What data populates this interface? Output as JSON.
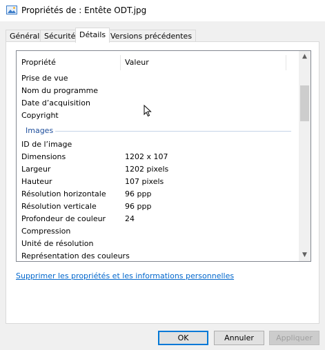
{
  "window": {
    "title": "Propriétés de : Entête ODT.jpg"
  },
  "tabs": [
    {
      "label": "Général",
      "active": false
    },
    {
      "label": "Sécurité",
      "active": false
    },
    {
      "label": "Détails",
      "active": true
    },
    {
      "label": "Versions précédentes",
      "active": false
    }
  ],
  "details": {
    "columns": {
      "property": "Propriété",
      "value": "Valeur"
    },
    "rows_before": [
      {
        "property": "Prise de vue",
        "value": ""
      },
      {
        "property": "Nom du programme",
        "value": ""
      },
      {
        "property": "Date d’acquisition",
        "value": ""
      },
      {
        "property": "Copyright",
        "value": ""
      }
    ],
    "group_label": "Images",
    "rows_images": [
      {
        "property": "ID de l’image",
        "value": ""
      },
      {
        "property": "Dimensions",
        "value": "1202 x 107"
      },
      {
        "property": "Largeur",
        "value": "1202 pixels"
      },
      {
        "property": "Hauteur",
        "value": "107 pixels"
      },
      {
        "property": "Résolution horizontale",
        "value": "96 ppp"
      },
      {
        "property": "Résolution verticale",
        "value": "96 ppp"
      },
      {
        "property": "Profondeur de couleur",
        "value": "24"
      },
      {
        "property": "Compression",
        "value": ""
      },
      {
        "property": "Unité de résolution",
        "value": ""
      },
      {
        "property": "Représentation des couleurs",
        "value": ""
      }
    ]
  },
  "remove_link": "Supprimer les propriétés et les informations personnelles",
  "buttons": {
    "ok": "OK",
    "cancel": "Annuler",
    "apply": "Appliquer"
  },
  "colors": {
    "accent": "#0078d7",
    "link": "#0066cc",
    "group": "#1e4e9c"
  }
}
